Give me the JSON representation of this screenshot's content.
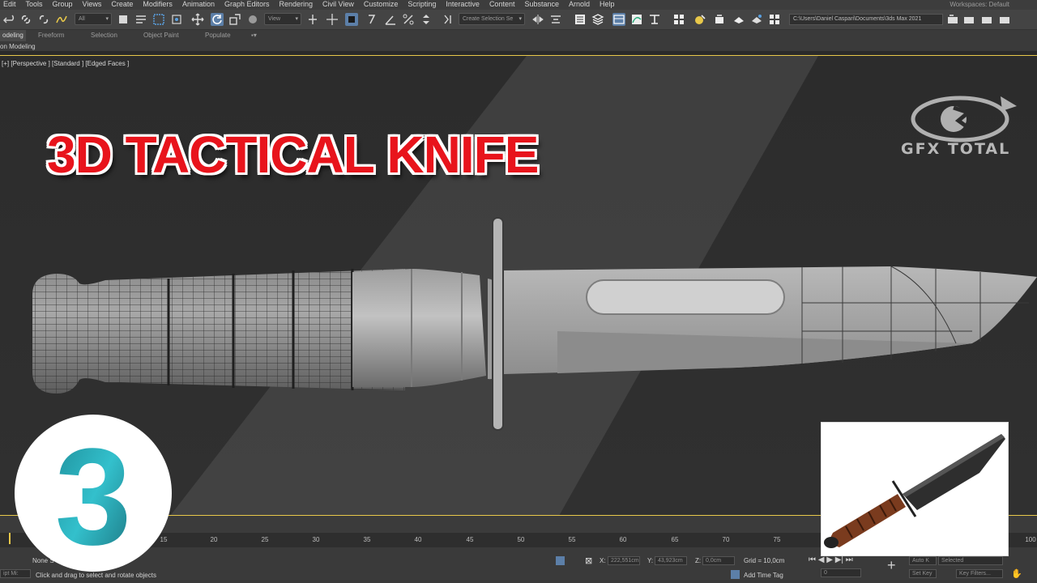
{
  "menu": {
    "items": [
      "Edit",
      "Tools",
      "Group",
      "Views",
      "Create",
      "Modifiers",
      "Animation",
      "Graph Editors",
      "Rendering",
      "Civil View",
      "Customize",
      "Scripting",
      "Interactive",
      "Content",
      "Substance",
      "Arnold",
      "Help"
    ],
    "workspace_label": "Workspaces:",
    "workspace_value": "Default"
  },
  "toolbar": {
    "filter_value": "All",
    "reference_coord": "View",
    "selection_set_placeholder": "Create Selection Se",
    "project_path": "C:\\Users\\Daniel Caspari\\Documents\\3ds Max 2021"
  },
  "ribbon": {
    "tabs": [
      "odeling",
      "Freeform",
      "Selection",
      "Object Paint",
      "Populate"
    ],
    "sub_label": "on Modeling"
  },
  "viewport": {
    "label": "[+] [Perspective ] [Standard ] [Edged Faces ]"
  },
  "overlay": {
    "title": "3D TACTICAL KNIFE",
    "brand": "GFX TOTAL",
    "logo_glyph": "3"
  },
  "timeline": {
    "ticks": [
      "15",
      "20",
      "25",
      "30",
      "35",
      "40",
      "45",
      "50",
      "55",
      "60",
      "65",
      "70",
      "75",
      "100"
    ]
  },
  "status": {
    "selection": "None S",
    "script_label": "ipt Mi:",
    "prompt": "Click and drag to select and rotate objects",
    "x_label": "X:",
    "x_value": "222,551cm",
    "y_label": "Y:",
    "y_value": "43,923cm",
    "z_label": "Z:",
    "z_value": "0,0cm",
    "grid": "Grid = 10,0cm",
    "add_time_tag": "Add Time Tag",
    "frame_value": "0",
    "auto_key": "Auto K",
    "selected": "Selected",
    "set_key": "Set Key",
    "key_filters": "Key Filters..."
  },
  "colors": {
    "title_red": "#e8141c",
    "accent_yellow": "#e8c84a",
    "max_teal": "#2fb3c0"
  }
}
